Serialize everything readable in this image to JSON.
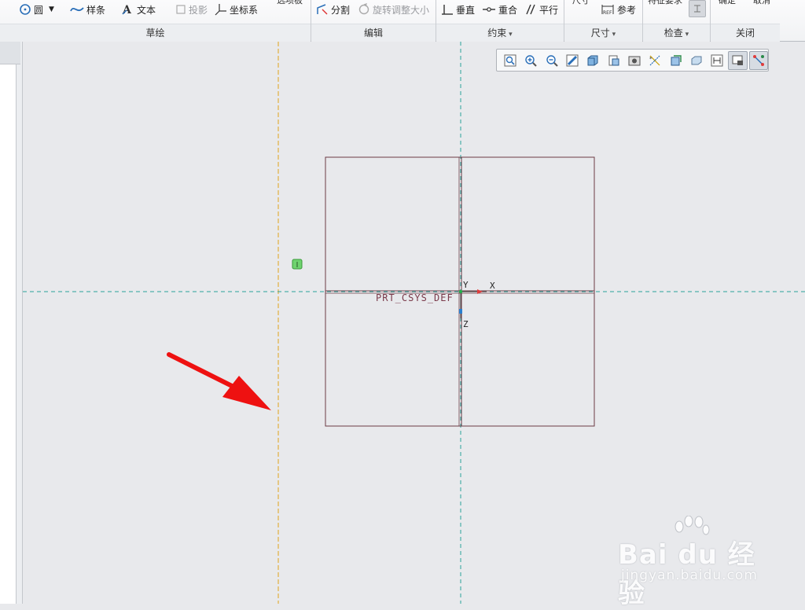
{
  "ribbon": {
    "groups": [
      {
        "label": "草绘",
        "menu": false
      },
      {
        "label": "编辑",
        "menu": false
      },
      {
        "label": "约束",
        "menu": true
      },
      {
        "label": "尺寸",
        "menu": true
      },
      {
        "label": "检查",
        "menu": true
      },
      {
        "label": "关闭",
        "menu": false
      }
    ],
    "sketch": {
      "circle": "圆",
      "spline": "样条",
      "text": "文本",
      "project": "投影",
      "csys": "坐标系",
      "clipped_top": "选项板"
    },
    "edit": {
      "divide": "分割",
      "rotate_resize": "旋转调整大小"
    },
    "constrain": {
      "perpendicular": "垂直",
      "coincident": "重合",
      "parallel": "平行"
    },
    "dimension": {
      "reference": "参考",
      "clipped_top": "尺寸"
    },
    "inspect": {
      "clipped_top": "特征要求"
    },
    "close": {
      "clipped_top_ok": "确定",
      "clipped_top_cancel": "取消"
    }
  },
  "canvas": {
    "csys_name": "PRT_CSYS_DEF",
    "axis_x": "X",
    "axis_y": "Y",
    "axis_z": "Z"
  },
  "watermark": {
    "brand": "Bai du 经验",
    "url": "jingyan.baidu.com"
  },
  "colors": {
    "sketch_line": "#6b3a45",
    "centerline": "#2aa39a",
    "reference_line": "#e0a21a",
    "arrow": "#ee1111"
  },
  "graphics_toolbar_icons": [
    "refit-icon",
    "zoom-in-icon",
    "zoom-out-icon",
    "repaint-icon",
    "display-style-icon",
    "saved-orientations-icon",
    "view-manager-icon",
    "datum-display-icon",
    "spin-center-icon",
    "shading-icon",
    "annotation-display-icon",
    "sketch-view-icon",
    "sketch-display-icon"
  ]
}
